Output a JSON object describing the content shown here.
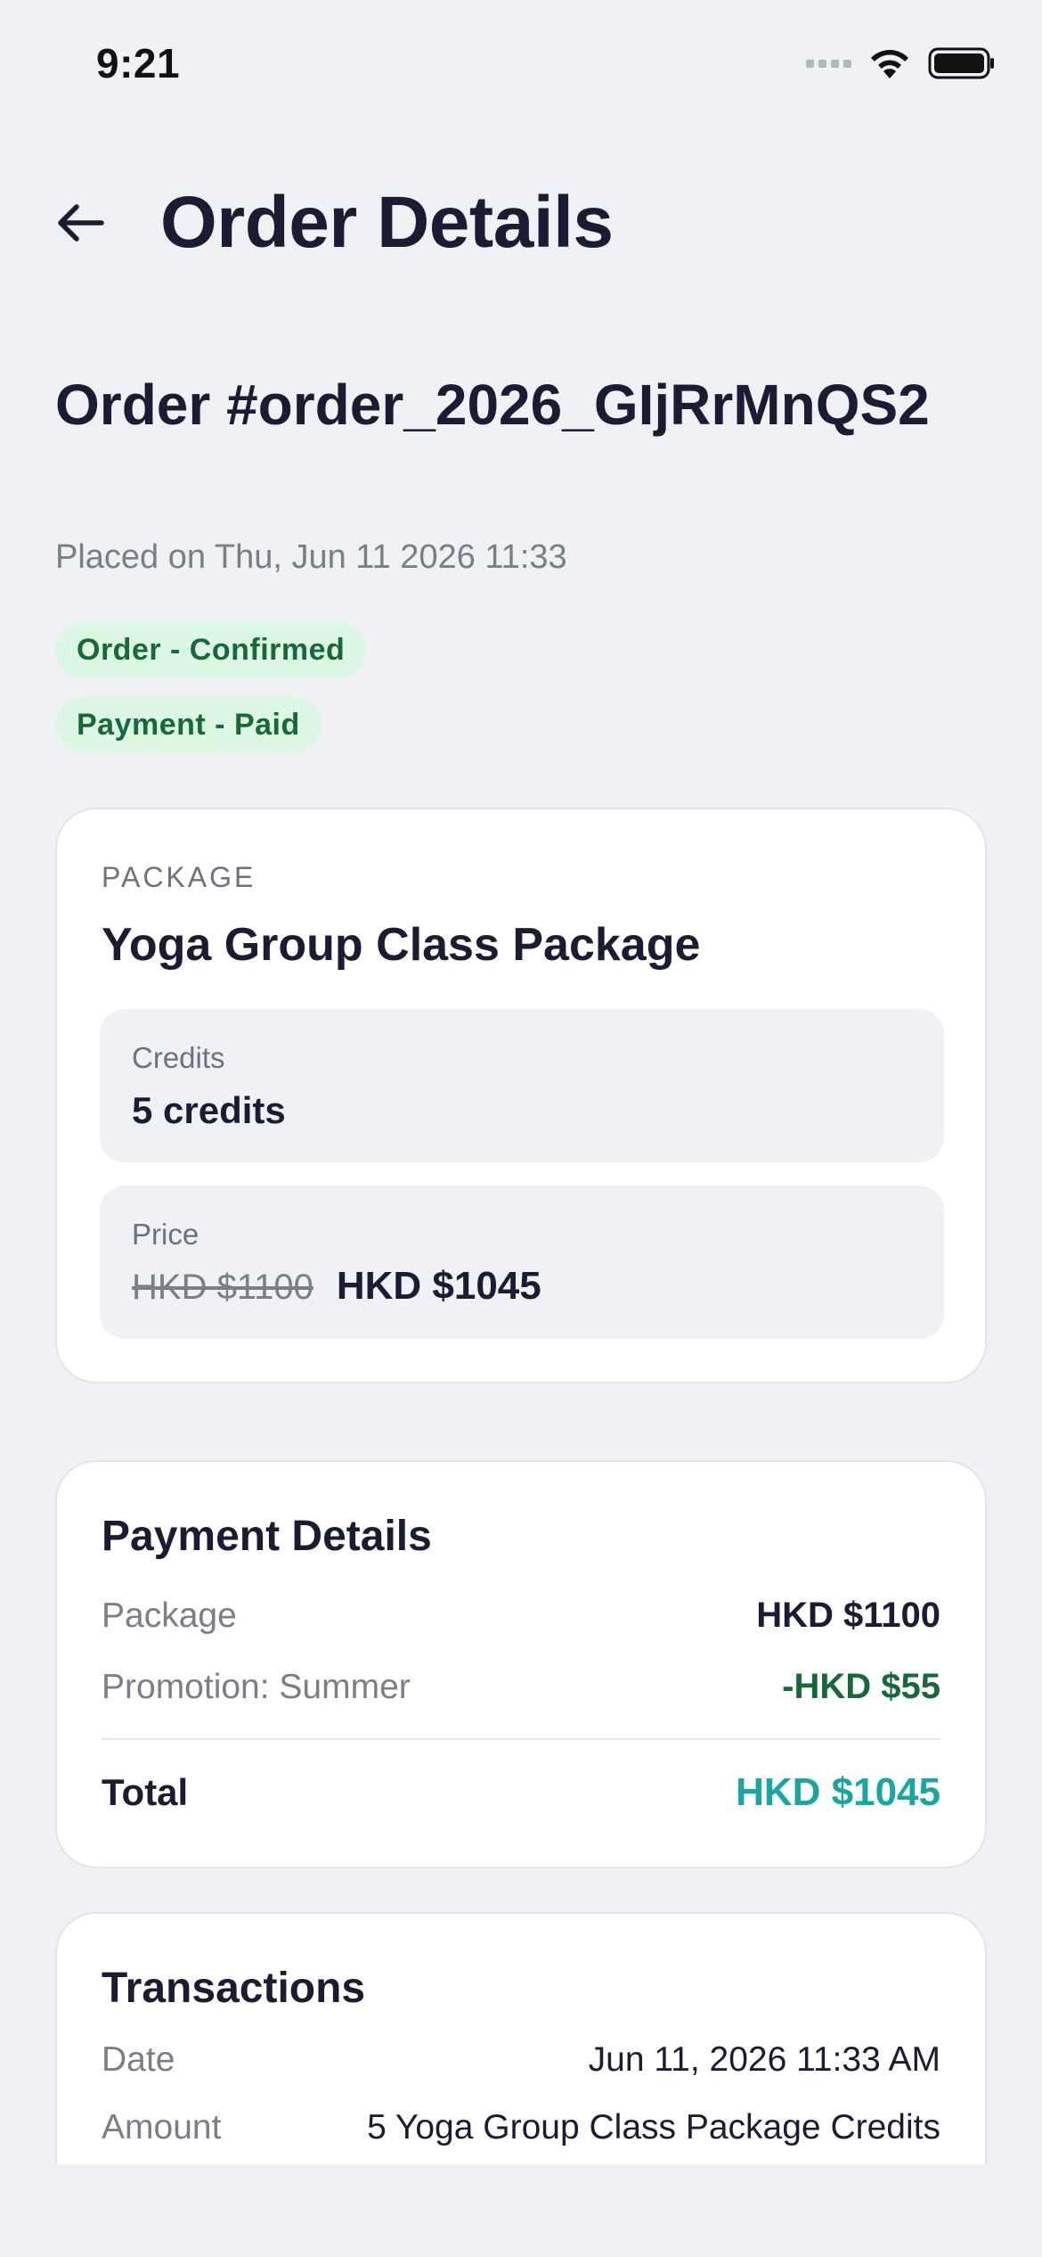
{
  "status_bar": {
    "time": "9:21",
    "icons": [
      "cellular-signal-icon",
      "wifi-icon",
      "battery-icon"
    ]
  },
  "header": {
    "back_icon": "arrow-left-icon",
    "title": "Order Details"
  },
  "order": {
    "heading": "Order #order_2026_GIjRrMnQS2",
    "placed_on": "Placed on Thu, Jun 11 2026 11:33",
    "order_status": "Order - Confirmed",
    "payment_status": "Payment - Paid"
  },
  "package": {
    "eyebrow": "PACKAGE",
    "name": "Yoga Group Class Package",
    "credits_label": "Credits",
    "credits_value": "5 credits",
    "price_label": "Price",
    "price_original": "HKD $1100",
    "price_final": "HKD $1045"
  },
  "payment": {
    "title": "Payment Details",
    "package_label": "Package",
    "package_value": "HKD $1100",
    "promotion_label": "Promotion: Summer",
    "promotion_value": "-HKD $55",
    "total_label": "Total",
    "total_value": "HKD $1045"
  },
  "transactions": {
    "title": "Transactions",
    "date_label": "Date",
    "date_value": "Jun 11, 2026 11:33 AM",
    "amount_label": "Amount",
    "amount_value": "5 Yoga Group Class Package Credits"
  },
  "colors": {
    "background": "#f0f1f5",
    "text_primary": "#1b1c33",
    "text_secondary": "#7b7d88",
    "badge_bg": "#dcf7e3",
    "badge_text": "#17693a",
    "total_accent": "#19a6a0"
  }
}
